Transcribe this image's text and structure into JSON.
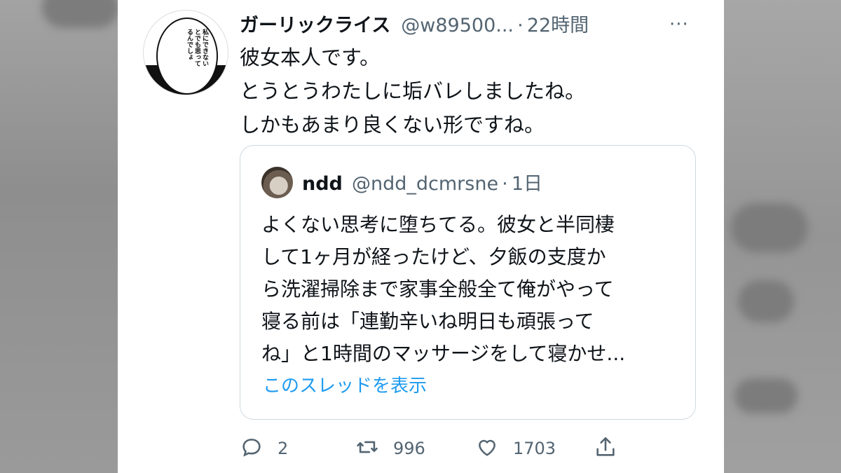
{
  "tweet": {
    "display_name": "ガーリックライス",
    "handle": "@w89500...",
    "dot": "·",
    "time": "22時間",
    "more_label": "···",
    "avatar_text": "私にできないとでも思ってるんでしょ",
    "lines": [
      "彼女本人です。",
      "とうとうわたしに垢バレしましたね。",
      "しかもあまり良くない形ですね。"
    ]
  },
  "quote": {
    "display_name": "ndd",
    "handle": "@ndd_dcmrsne",
    "dot": "·",
    "time": "1日",
    "lines": [
      "よくない思考に堕ちてる。彼女と半同棲",
      "して1ヶ月が経ったけど、夕飯の支度か",
      "ら洗濯掃除まで家事全般全て俺がやって",
      "寝る前は「連勤辛いね明日も頑張って",
      "ね」と1時間のマッサージをして寝かせ..."
    ],
    "show_thread": "このスレッドを表示"
  },
  "actions": {
    "reply_count": "2",
    "retweet_count": "996",
    "like_count": "1703"
  },
  "colors": {
    "text": "#0f1419",
    "secondary": "#536471",
    "link": "#1d9bf0",
    "border": "#cfd9de"
  }
}
